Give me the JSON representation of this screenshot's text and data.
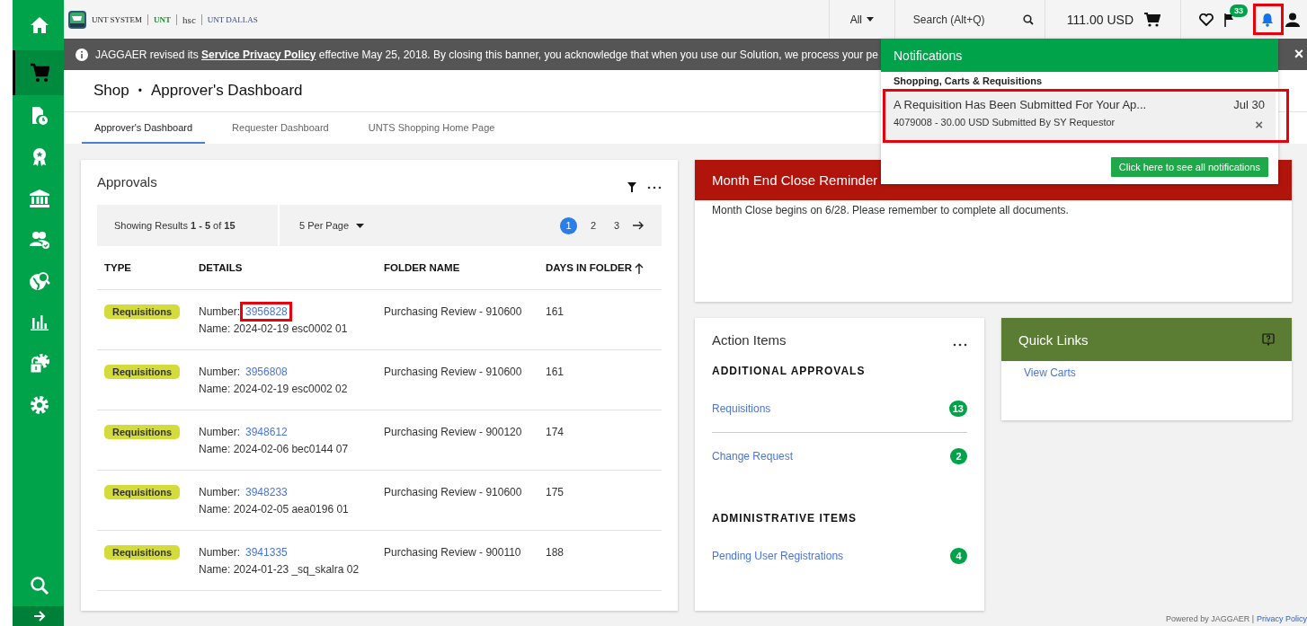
{
  "sidebar": {
    "items": [
      {
        "selected": false
      },
      {
        "selected": true
      },
      {
        "selected": false
      },
      {
        "selected": false
      },
      {
        "selected": false
      },
      {
        "selected": false
      },
      {
        "selected": false
      },
      {
        "selected": false
      },
      {
        "selected": false
      },
      {
        "selected": false
      }
    ]
  },
  "top_bar": {
    "logos": [
      "UNT SYSTEM",
      "UNT",
      "hsc",
      "UNT DALLAS"
    ],
    "scope": "All",
    "search_placeholder": "Search (Alt+Q)",
    "cart_total": "111.00 USD",
    "flag_count": "33"
  },
  "banner": {
    "before": "JAGGAER revised its ",
    "link": "Service Privacy Policy",
    "after": " effective May 25, 2018. By closing this banner, you acknowledge that when you use our Solution, we process your pe",
    "close": "×"
  },
  "page_header": {
    "section": "Shop",
    "separator": "•",
    "title": "Approver's Dashboard"
  },
  "tabs": [
    {
      "label": "Approver's Dashboard",
      "selected": true
    },
    {
      "label": "Requester Dashboard",
      "selected": false
    },
    {
      "label": "UNTS Shopping Home Page",
      "selected": false
    }
  ],
  "approvals": {
    "title": "Approvals",
    "results": "Showing Results **1 - 5** of **15**",
    "per_page": "5 Per Page",
    "pages": [
      {
        "label": "1",
        "selected": true
      },
      {
        "label": "2",
        "selected": false
      },
      {
        "label": "3",
        "selected": false
      }
    ],
    "columns": [
      "TYPE",
      "DETAILS",
      "FOLDER NAME",
      "DAYS IN FOLDER"
    ],
    "rows": [
      {
        "type": "Requisitions",
        "number_label": "Number:",
        "number": "3956828",
        "name": "Name: 2024-02-19 esc0002 01",
        "folder": "Purchasing Review - 910600",
        "days": "161"
      },
      {
        "type": "Requisitions",
        "number_label": "Number:",
        "number": "3956808",
        "name": "Name: 2024-02-19 esc0002 02",
        "folder": "Purchasing Review - 910600",
        "days": "161"
      },
      {
        "type": "Requisitions",
        "number_label": "Number:",
        "number": "3948612",
        "name": "Name: 2024-02-06 bec0144 07",
        "folder": "Purchasing Review - 900120",
        "days": "174"
      },
      {
        "type": "Requisitions",
        "number_label": "Number:",
        "number": "3948233",
        "name": "Name: 2024-02-05 aea0196 01",
        "folder": "Purchasing Review - 910600",
        "days": "175"
      },
      {
        "type": "Requisitions",
        "number_label": "Number:",
        "number": "3941335",
        "name": "Name: 2024-01-23 _sq_skalra 02",
        "folder": "Purchasing Review - 900110",
        "days": "188"
      }
    ]
  },
  "month_end": {
    "title": "Month End Close Reminder",
    "body": "Month Close begins on 6/28.  Please remember to complete all documents."
  },
  "action_items": {
    "title": "Action Items",
    "sections": [
      {
        "heading": "ADDITIONAL APPROVALS",
        "items": [
          {
            "label": "Requisitions",
            "count": "13"
          },
          {
            "label": "Change Request",
            "count": "2"
          }
        ]
      },
      {
        "heading": "ADMINISTRATIVE ITEMS",
        "items": [
          {
            "label": "Pending User Registrations",
            "count": "4"
          }
        ]
      }
    ]
  },
  "quick_links": {
    "title": "Quick Links",
    "links": [
      "View Carts"
    ]
  },
  "notifications": {
    "title": "Notifications",
    "section": "Shopping, Carts & Requisitions",
    "items": [
      {
        "title": "A Requisition Has Been Submitted For Your Ap...",
        "date": "Jul 30",
        "detail": "4079008 - 30.00 USD Submitted By SY Requestor",
        "close": "×"
      }
    ],
    "button": "Click here to see all notifications"
  },
  "footer": {
    "text": "Powered by JAGGAER |",
    "link": "Privacy Policy"
  }
}
